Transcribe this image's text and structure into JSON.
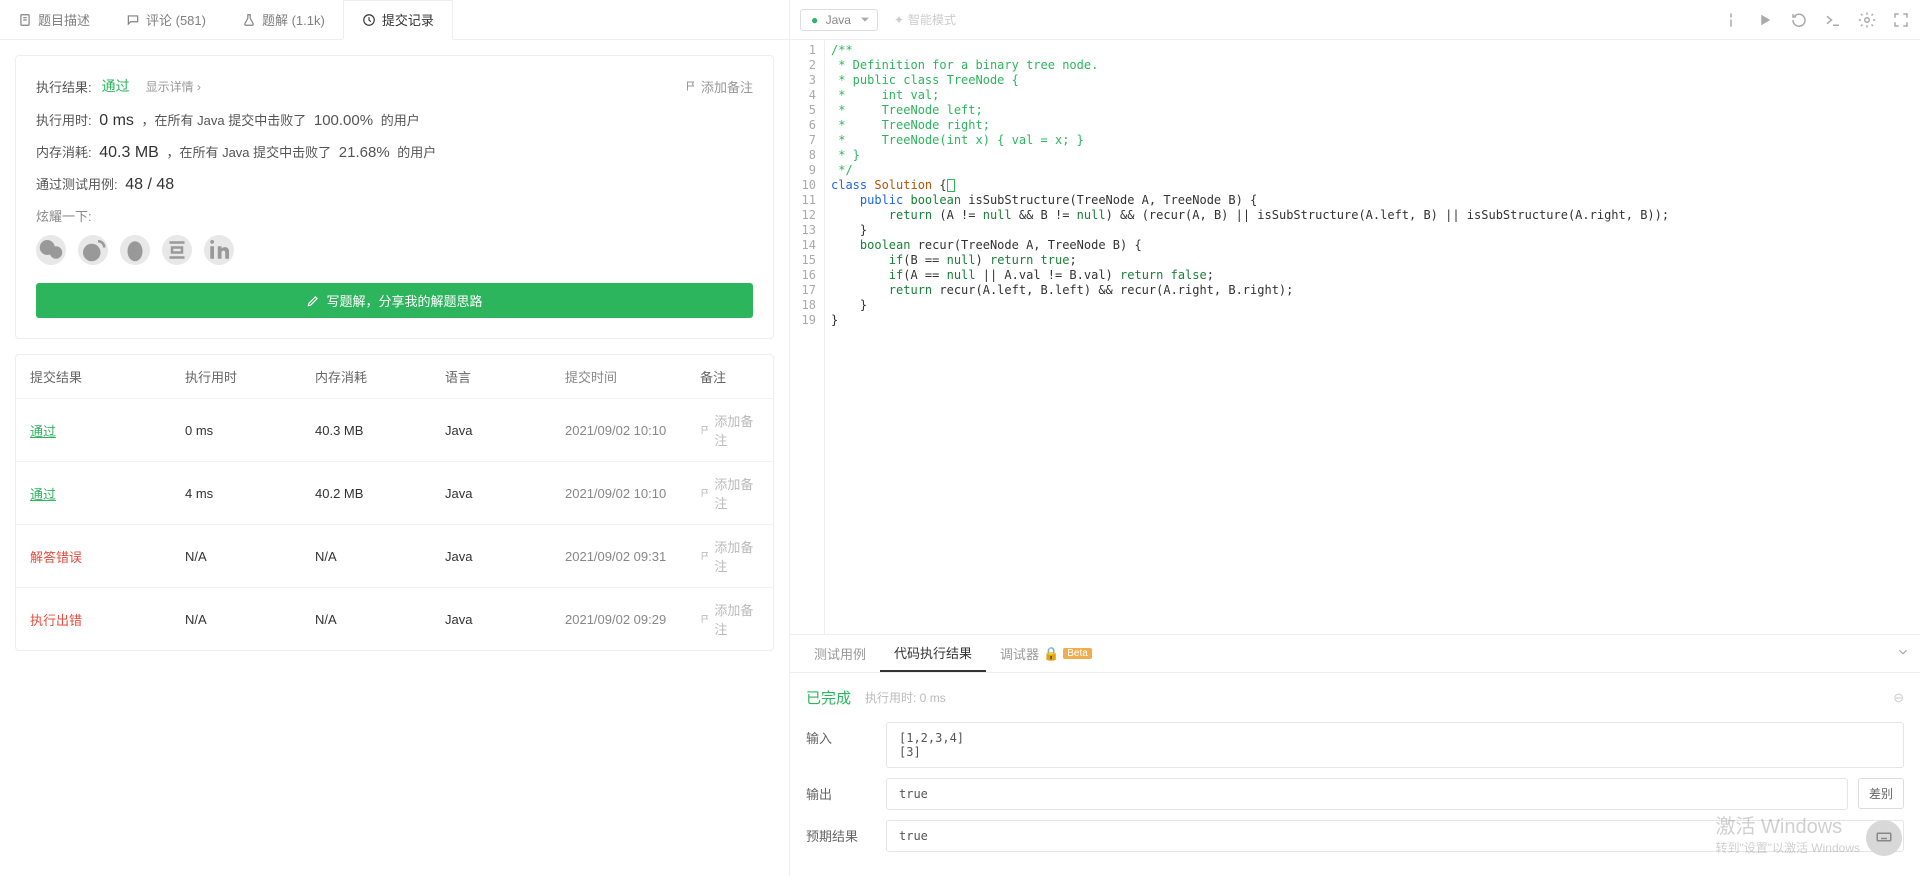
{
  "tabs": [
    {
      "label": "题目描述"
    },
    {
      "label": "评论 (581)"
    },
    {
      "label": "题解 (1.1k)"
    },
    {
      "label": "提交记录"
    }
  ],
  "result_label": "执行结果:",
  "result_status": "通过",
  "show_detail": "显示详情 ›",
  "add_remark": "添加备注",
  "runtime_label": "执行用时:",
  "runtime_val": "0 ms",
  "runtime_text1": "，在所有 Java 提交中击败了",
  "runtime_pct": "100.00%",
  "runtime_text2": "的用户",
  "memory_label": "内存消耗:",
  "memory_val": "40.3 MB",
  "memory_text1": "，在所有 Java 提交中击败了",
  "memory_pct": "21.68%",
  "memory_text2": "的用户",
  "cases_label": "通过测试用例:",
  "cases_val": "48 / 48",
  "share_label": "炫耀一下:",
  "write_solution": "写题解，分享我的解题思路",
  "thead": {
    "status": "提交结果",
    "time": "执行用时",
    "mem": "内存消耗",
    "lang": "语言",
    "date": "提交时间",
    "remark": "备注"
  },
  "submissions": [
    {
      "status": "通过",
      "cls": "pass",
      "time": "0 ms",
      "mem": "40.3 MB",
      "lang": "Java",
      "date": "2021/09/02 10:10"
    },
    {
      "status": "通过",
      "cls": "pass",
      "time": "4 ms",
      "mem": "40.2 MB",
      "lang": "Java",
      "date": "2021/09/02 10:10"
    },
    {
      "status": "解答错误",
      "cls": "fail",
      "time": "N/A",
      "mem": "N/A",
      "lang": "Java",
      "date": "2021/09/02 09:31"
    },
    {
      "status": "执行出错",
      "cls": "fail",
      "time": "N/A",
      "mem": "N/A",
      "lang": "Java",
      "date": "2021/09/02 09:29"
    }
  ],
  "editor": {
    "lang": "Java",
    "smart_mode": "智能模式"
  },
  "code_lines": [
    [
      [
        "cm",
        "/**"
      ]
    ],
    [
      [
        "cm",
        " * Definition for a binary tree node."
      ]
    ],
    [
      [
        "cm",
        " * public class TreeNode {"
      ]
    ],
    [
      [
        "cm",
        " *     int val;"
      ]
    ],
    [
      [
        "cm",
        " *     TreeNode left;"
      ]
    ],
    [
      [
        "cm",
        " *     TreeNode right;"
      ]
    ],
    [
      [
        "cm",
        " *     TreeNode(int x) { val = x; }"
      ]
    ],
    [
      [
        "cm",
        " * }"
      ]
    ],
    [
      [
        "cm",
        " */"
      ]
    ],
    [
      [
        "kw2",
        "class "
      ],
      [
        "cl",
        "Solution "
      ],
      [
        "",
        "{"
      ],
      [
        "cursor",
        ""
      ]
    ],
    [
      [
        "",
        "    "
      ],
      [
        "kw2",
        "public "
      ],
      [
        "kw",
        "boolean "
      ],
      [
        "fn",
        "isSubStructure"
      ],
      [
        "",
        "(TreeNode A, TreeNode B) {"
      ]
    ],
    [
      [
        "",
        "        "
      ],
      [
        "kw",
        "return "
      ],
      [
        "",
        "(A != "
      ],
      [
        "kw",
        "null"
      ],
      [
        "",
        " && B != "
      ],
      [
        "kw",
        "null"
      ],
      [
        "",
        ") && (recur(A, B) || isSubStructure(A.left, B) || isSubStructure(A.right, B));"
      ]
    ],
    [
      [
        "",
        "    }"
      ]
    ],
    [
      [
        "",
        "    "
      ],
      [
        "kw",
        "boolean "
      ],
      [
        "fn",
        "recur"
      ],
      [
        "",
        "(TreeNode A, TreeNode B) {"
      ]
    ],
    [
      [
        "",
        "        "
      ],
      [
        "kw",
        "if"
      ],
      [
        "",
        "(B == "
      ],
      [
        "kw",
        "null"
      ],
      [
        "",
        ") "
      ],
      [
        "kw",
        "return true"
      ],
      [
        "",
        ";"
      ]
    ],
    [
      [
        "",
        "        "
      ],
      [
        "kw",
        "if"
      ],
      [
        "",
        "(A == "
      ],
      [
        "kw",
        "null"
      ],
      [
        "",
        " || A.val != B.val) "
      ],
      [
        "kw",
        "return false"
      ],
      [
        "",
        ";"
      ]
    ],
    [
      [
        "",
        "        "
      ],
      [
        "kw",
        "return "
      ],
      [
        "",
        "recur(A.left, B.left) && recur(A.right, B.right);"
      ]
    ],
    [
      [
        "",
        "    }"
      ]
    ],
    [
      [
        "",
        "}"
      ]
    ]
  ],
  "bottom_tabs": {
    "t1": "测试用例",
    "t2": "代码执行结果",
    "t3": "调试器",
    "beta": "Beta"
  },
  "done": "已完成",
  "done_time": "执行用时:  0 ms",
  "io": {
    "input_label": "输入",
    "input_val": "[1,2,3,4]\n[3]",
    "output_label": "输出",
    "output_val": "true",
    "expected_label": "预期结果",
    "expected_val": "true",
    "diff": "差别"
  },
  "watermark": {
    "l1": "激活 Windows",
    "l2": "转到\"设置\"以激活 Windows"
  }
}
